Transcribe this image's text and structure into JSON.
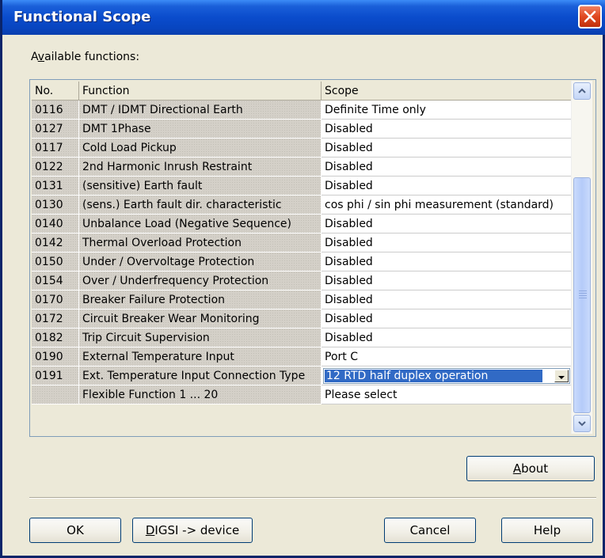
{
  "window": {
    "title": "Functional Scope"
  },
  "available_label": "Available functions:",
  "available_label_parts": [
    "A",
    "v",
    "ailable functions:"
  ],
  "table": {
    "headers": {
      "no": "No.",
      "function": "Function",
      "scope": "Scope"
    },
    "rows": [
      {
        "no": "0116",
        "function": "DMT / IDMT Directional Earth",
        "scope": "Definite Time only"
      },
      {
        "no": "0127",
        "function": "DMT 1Phase",
        "scope": "Disabled"
      },
      {
        "no": "0117",
        "function": "Cold Load Pickup",
        "scope": "Disabled"
      },
      {
        "no": "0122",
        "function": "2nd Harmonic Inrush Restraint",
        "scope": "Disabled"
      },
      {
        "no": "0131",
        "function": "(sensitive) Earth fault",
        "scope": "Disabled"
      },
      {
        "no": "0130",
        "function": "(sens.) Earth fault dir. characteristic",
        "scope": "cos phi / sin phi measurement (standard)"
      },
      {
        "no": "0140",
        "function": "Unbalance Load (Negative Sequence)",
        "scope": "Disabled"
      },
      {
        "no": "0142",
        "function": "Thermal Overload Protection",
        "scope": "Disabled"
      },
      {
        "no": "0150",
        "function": "Under / Overvoltage Protection",
        "scope": "Disabled"
      },
      {
        "no": "0154",
        "function": "Over / Underfrequency Protection",
        "scope": "Disabled"
      },
      {
        "no": "0170",
        "function": "Breaker Failure Protection",
        "scope": "Disabled"
      },
      {
        "no": "0172",
        "function": "Circuit Breaker Wear Monitoring",
        "scope": "Disabled"
      },
      {
        "no": "0182",
        "function": "Trip Circuit Supervision",
        "scope": "Disabled"
      },
      {
        "no": "0190",
        "function": "External Temperature Input",
        "scope": "Port C"
      },
      {
        "no": "0191",
        "function": "Ext. Temperature Input Connection Type",
        "scope": "12 RTD half duplex operation"
      },
      {
        "no": "",
        "function": "Flexible Function 1 ... 20",
        "scope": "Please select"
      }
    ],
    "selected_row_index": 14
  },
  "buttons": {
    "about": {
      "underline": "A",
      "rest": "bout"
    },
    "ok": "OK",
    "digsi": {
      "underline": "D",
      "rest": "IGSI -> device"
    },
    "cancel": "Cancel",
    "help": "Help"
  },
  "colors": {
    "titlebar": "#0a4ccc",
    "selection": "#316ac5",
    "close": "#e04820"
  },
  "icons": [
    "close-icon",
    "scroll-up-icon",
    "scroll-down-icon",
    "dropdown-arrow-icon"
  ]
}
